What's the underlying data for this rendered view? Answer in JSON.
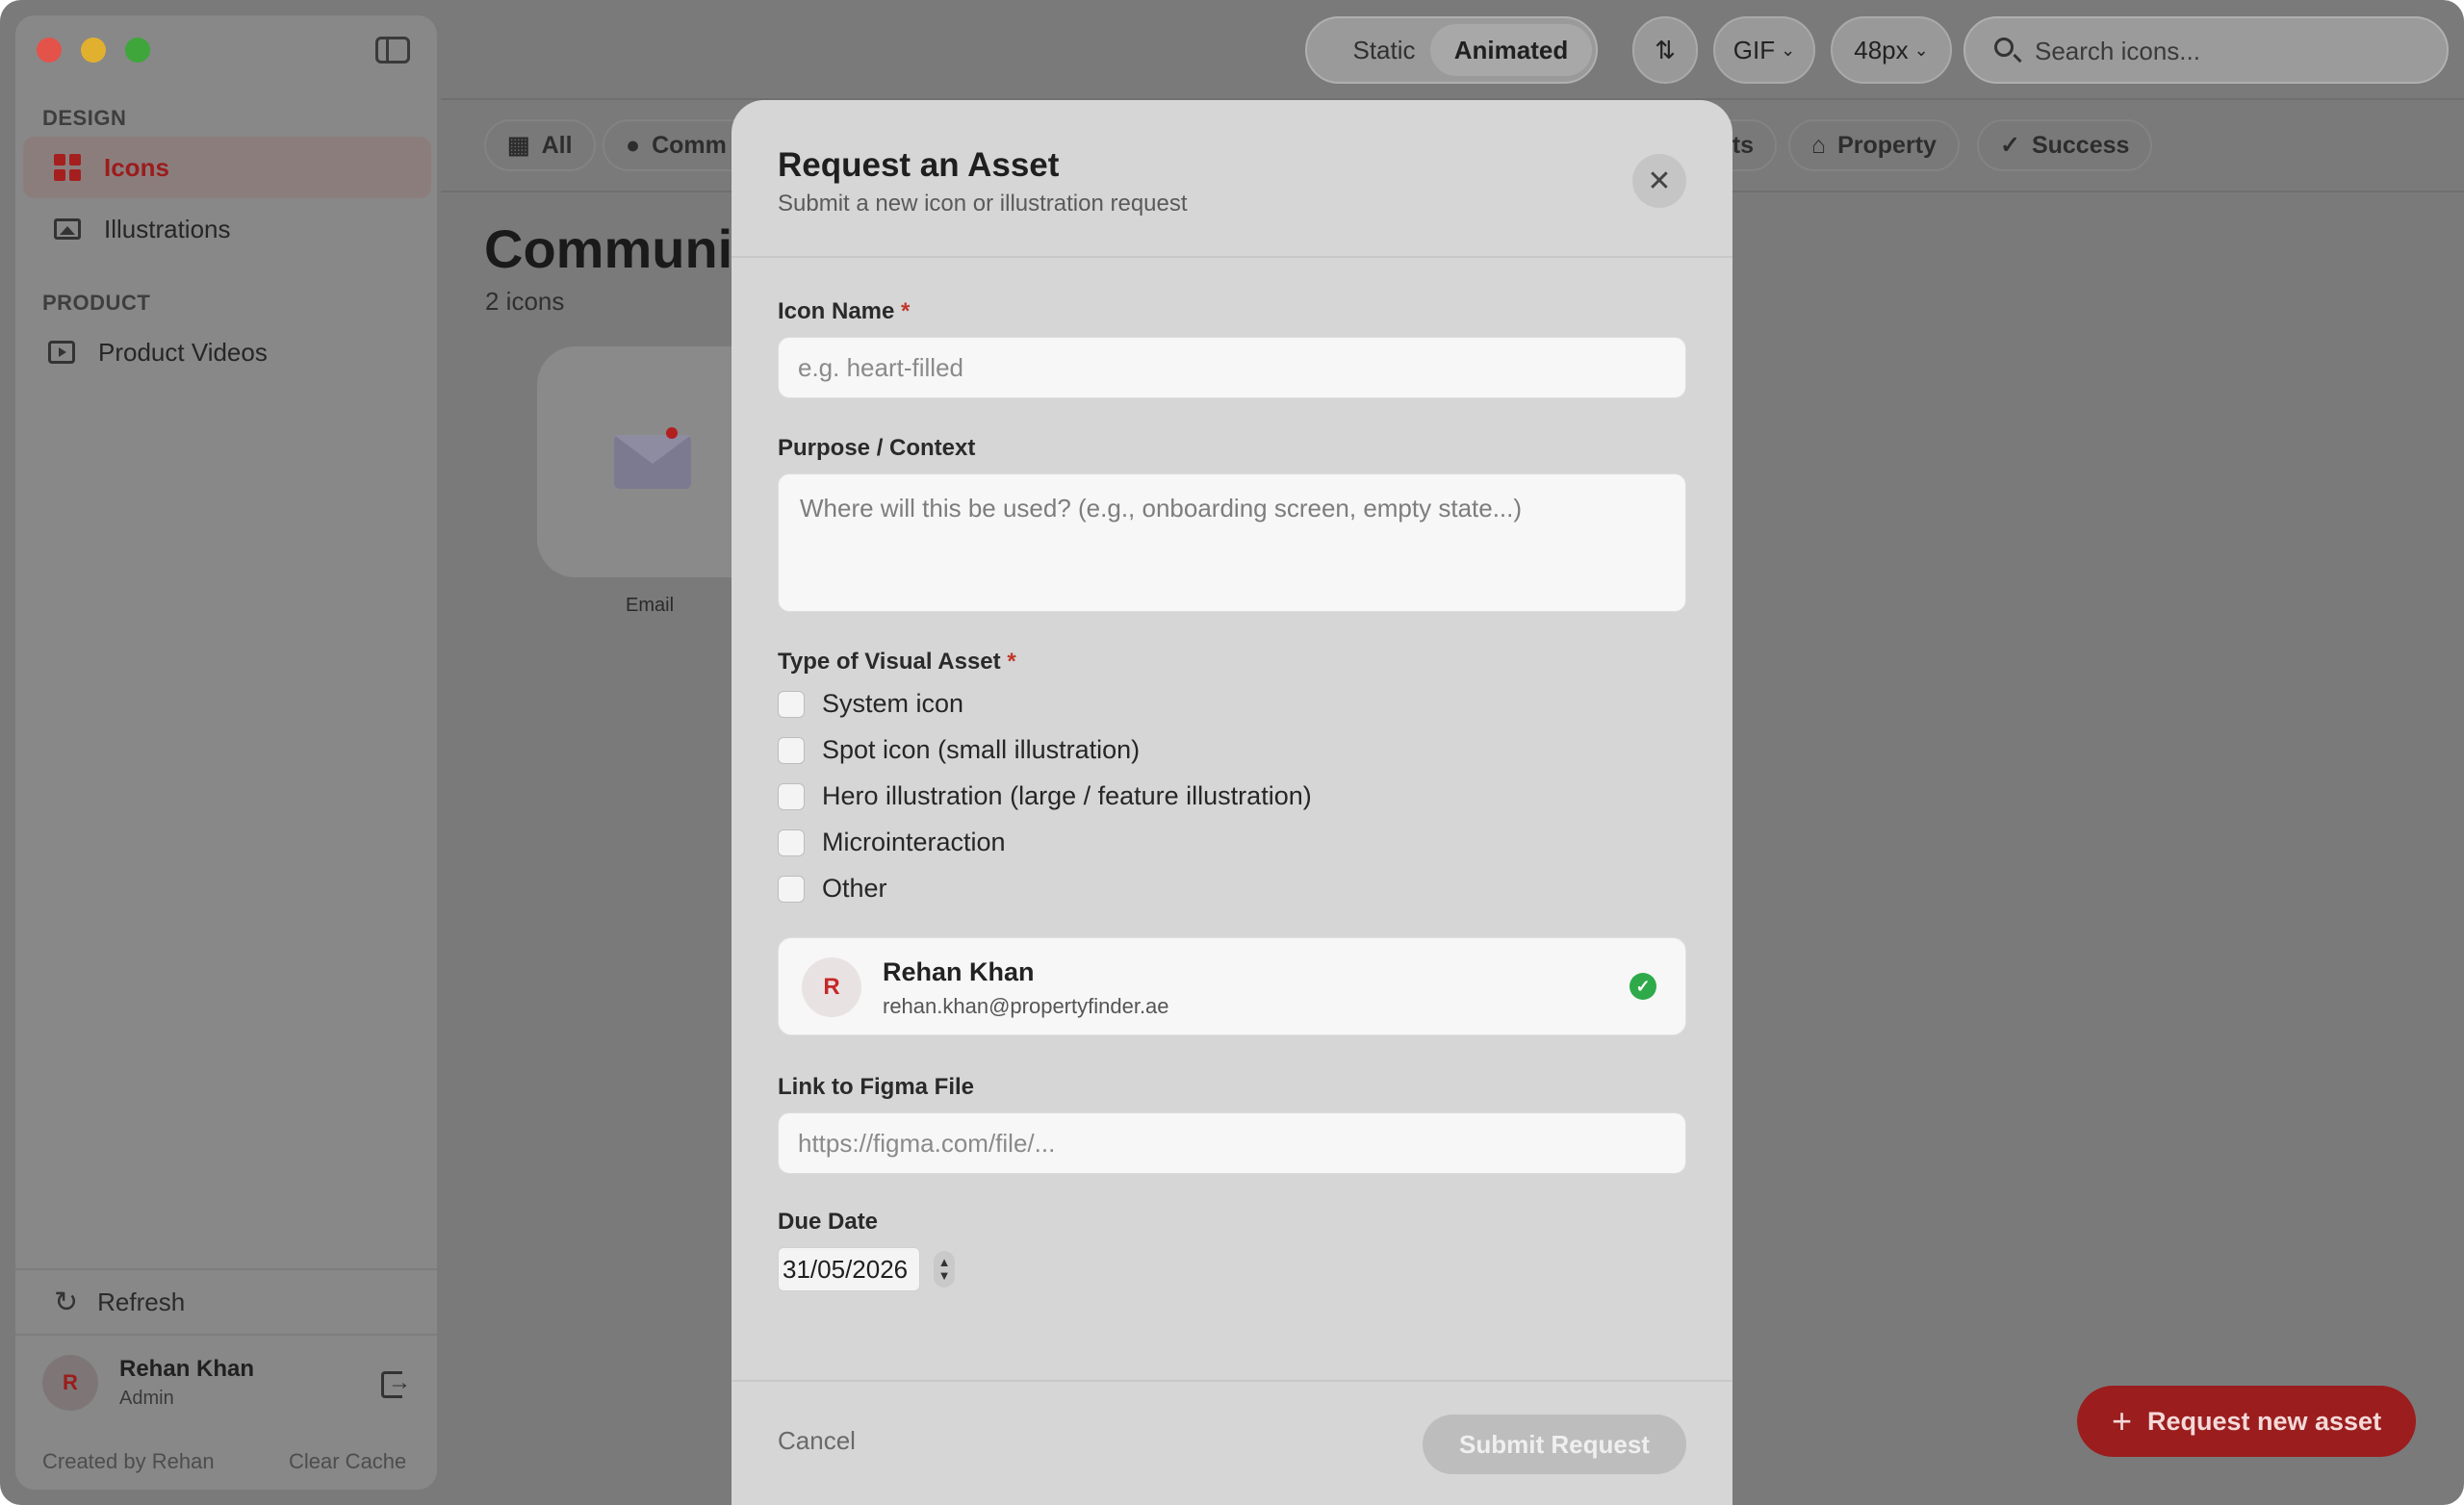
{
  "window": {
    "sidebar": {
      "sections": [
        {
          "title": "DESIGN",
          "items": [
            {
              "label": "Icons",
              "active": true,
              "icon": "grid-icon"
            },
            {
              "label": "Illustrations",
              "icon": "image-icon"
            }
          ]
        },
        {
          "title": "PRODUCT",
          "items": [
            {
              "label": "Product Videos",
              "icon": "play-icon"
            }
          ]
        }
      ],
      "refresh_label": "Refresh",
      "user": {
        "initial": "R",
        "name": "Rehan Khan",
        "role": "Admin"
      },
      "footer_left": "Created by Rehan",
      "footer_right": "Clear Cache"
    },
    "toolbar": {
      "segment_static": "Static",
      "segment_animated": "Animated",
      "format": "GIF",
      "size": "48px",
      "search_placeholder": "Search icons..."
    },
    "chips": [
      {
        "label": "All",
        "icon": "grid-icon"
      },
      {
        "label": "Comm",
        "icon": "chat-icon"
      },
      {
        "label": "ts",
        "icon": ""
      },
      {
        "label": "Property",
        "icon": "home-icon"
      },
      {
        "label": "Success",
        "icon": "check-circle-icon"
      }
    ],
    "page": {
      "title": "Communi",
      "count": "2 icons",
      "icon_caption": "Email"
    },
    "fab_label": "Request new asset"
  },
  "modal": {
    "title": "Request an Asset",
    "subtitle": "Submit a new icon or illustration request",
    "icon_name": {
      "label": "Icon Name",
      "required": "*",
      "placeholder": "e.g. heart-filled"
    },
    "purpose": {
      "label": "Purpose / Context",
      "placeholder": "Where will this be used? (e.g., onboarding screen, empty state...)"
    },
    "asset_type": {
      "label": "Type of Visual Asset",
      "required": "*",
      "options": [
        "System icon",
        "Spot icon (small illustration)",
        "Hero illustration (large / feature illustration)",
        "Microinteraction",
        "Other"
      ]
    },
    "requester": {
      "initial": "R",
      "name": "Rehan Khan",
      "email": "rehan.khan@propertyfinder.ae"
    },
    "figma": {
      "label": "Link to Figma File",
      "placeholder": "https://figma.com/file/..."
    },
    "due_date": {
      "label": "Due Date",
      "value": "31/05/2026"
    },
    "cancel_label": "Cancel",
    "submit_label": "Submit Request"
  },
  "colors": {
    "accent": "#9b1d1d",
    "overlay": "#7a7a7a",
    "modal_bg": "#d6d6d6",
    "success": "#2eaa4a"
  }
}
